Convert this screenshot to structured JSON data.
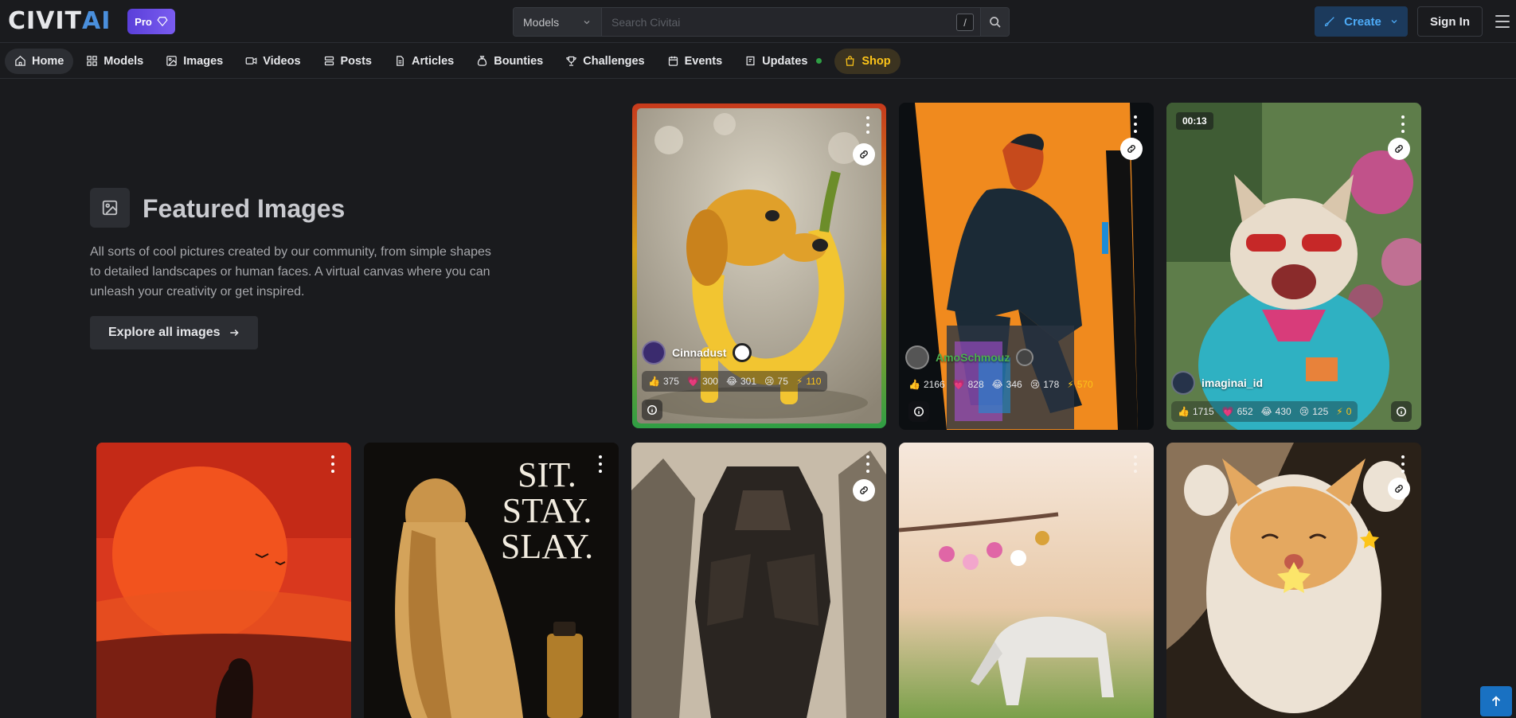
{
  "header": {
    "logo_text_left": "CIVIT",
    "logo_text_right": "AI",
    "pro_label": "Pro",
    "search_scope": "Models",
    "search_placeholder": "Search Civitai",
    "search_shortcut": "/",
    "create_label": "Create",
    "signin_label": "Sign In"
  },
  "nav": {
    "items": [
      {
        "label": "Home",
        "icon": "home-icon"
      },
      {
        "label": "Models",
        "icon": "grid-icon"
      },
      {
        "label": "Images",
        "icon": "image-icon"
      },
      {
        "label": "Videos",
        "icon": "video-icon"
      },
      {
        "label": "Posts",
        "icon": "posts-icon"
      },
      {
        "label": "Articles",
        "icon": "article-icon"
      },
      {
        "label": "Bounties",
        "icon": "moneybag-icon"
      },
      {
        "label": "Challenges",
        "icon": "trophy-icon"
      },
      {
        "label": "Events",
        "icon": "calendar-icon"
      },
      {
        "label": "Updates",
        "icon": "updates-icon"
      },
      {
        "label": "Shop",
        "icon": "shopping-bag-icon"
      }
    ]
  },
  "hero": {
    "title": "Featured Images",
    "description": "All sorts of cool pictures created by our community, from simple shapes to detailed landscapes or human faces. A virtual canvas where you can unleash your creativity or get inspired.",
    "cta": "Explore all images"
  },
  "cards": [
    {
      "user": "Cinnadust",
      "likes": "375",
      "hearts": "300",
      "laughs": "301",
      "cries": "75",
      "buzz": "110"
    },
    {
      "user": "AmoSchmouz",
      "likes": "2166",
      "hearts": "828",
      "laughs": "346",
      "cries": "178",
      "buzz": "570"
    },
    {
      "duration": "00:13",
      "user": "imaginai_id",
      "likes": "1715",
      "hearts": "652",
      "laughs": "430",
      "cries": "125",
      "buzz": "0"
    }
  ],
  "colors": {
    "accent": "#4dabf7",
    "pro": "#7a5cf0",
    "shop": "#fcc419",
    "scroll_top": "#1971c2"
  }
}
